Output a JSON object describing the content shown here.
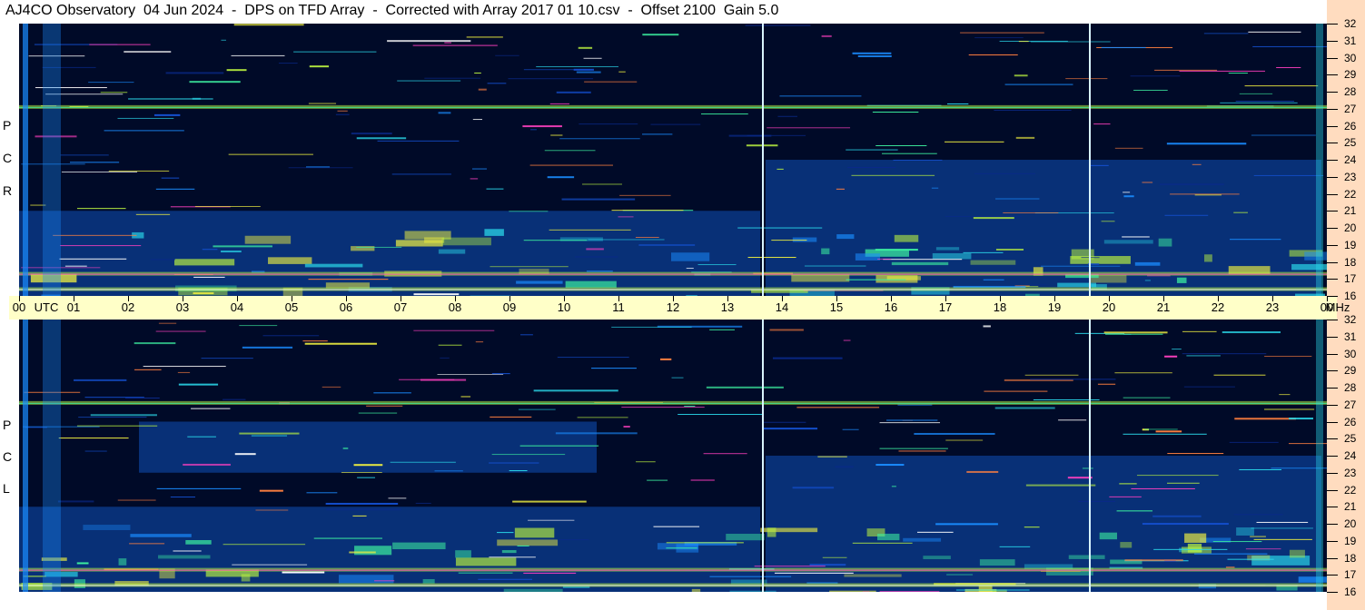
{
  "title": "AJ4CO Observatory  04 Jun 2024  -  DPS on TFD Array  -  Corrected with Array 2017 01 10.csv  -  Offset 2100  Gain 5.0",
  "top_panel_letters": [
    "P",
    "C",
    "R"
  ],
  "bottom_panel_letters": [
    "P",
    "C",
    "L"
  ],
  "colors": {
    "background": "#000a28",
    "axis_band": "#ffffc8",
    "right_strip": "#ffdcbf",
    "marker_line": "#d8f4ff"
  },
  "chart_data": [
    {
      "type": "heatmap",
      "panel": "RCP",
      "ylabel": "R C P",
      "xlim": [
        0,
        24
      ],
      "ylim": [
        16,
        32
      ],
      "marker_lines_utc": [
        13.65,
        19.65
      ],
      "bright_bands_mhz": [
        27.1,
        17.3,
        16.4
      ],
      "enhanced_regions": [
        {
          "utc": [
            0,
            13.6
          ],
          "mhz": [
            16,
            21
          ]
        },
        {
          "utc": [
            13.7,
            23.9
          ],
          "mhz": [
            16,
            24
          ]
        }
      ]
    },
    {
      "type": "heatmap",
      "panel": "LCP",
      "ylabel": "L C P",
      "xlim": [
        0,
        24
      ],
      "ylim": [
        16,
        32
      ],
      "marker_lines_utc": [
        13.65,
        19.65
      ],
      "bright_bands_mhz": [
        27.1,
        17.3,
        16.4
      ],
      "enhanced_regions": [
        {
          "utc": [
            2.2,
            10.6
          ],
          "mhz": [
            23,
            26
          ]
        },
        {
          "utc": [
            0,
            13.6
          ],
          "mhz": [
            16,
            21
          ]
        },
        {
          "utc": [
            13.7,
            23.9
          ],
          "mhz": [
            16,
            24
          ]
        }
      ]
    }
  ],
  "time_axis": {
    "ticks": [
      "00",
      "01",
      "02",
      "03",
      "04",
      "05",
      "06",
      "07",
      "08",
      "09",
      "10",
      "11",
      "12",
      "13",
      "14",
      "15",
      "16",
      "17",
      "18",
      "19",
      "20",
      "21",
      "22",
      "23",
      "00"
    ],
    "unit_label": "UTC",
    "freq_unit_label": "MHz"
  },
  "freq_axis": {
    "ticks": [
      "32",
      "31",
      "30",
      "29",
      "28",
      "27",
      "26",
      "25",
      "24",
      "23",
      "22",
      "21",
      "20",
      "19",
      "18",
      "17",
      "16"
    ]
  }
}
